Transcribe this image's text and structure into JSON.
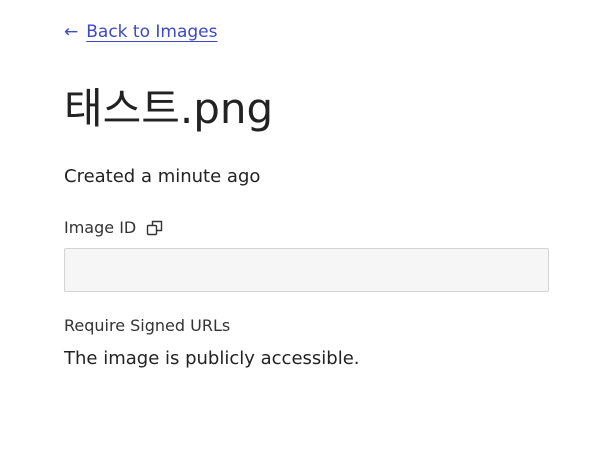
{
  "nav": {
    "back_arrow_icon": "arrow-left-icon",
    "back_label": "Back to Images"
  },
  "image": {
    "title": "태스트.png",
    "created": "Created a minute ago",
    "id_label": "Image ID",
    "copy_icon": "copy-icon",
    "id_value": ""
  },
  "signed_urls": {
    "label": "Require Signed URLs",
    "value": "The image is publicly accessible."
  },
  "colors": {
    "link": "#3d49c7",
    "text": "#222222",
    "input_background": "#f6f6f6",
    "input_border": "#d4d4d4"
  }
}
